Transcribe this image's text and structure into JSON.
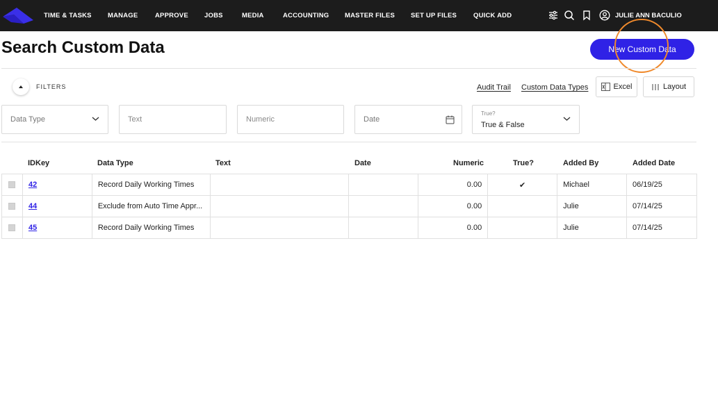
{
  "nav": {
    "items": [
      "TIME & TASKS",
      "MANAGE",
      "APPROVE",
      "JOBS",
      "MEDIA",
      "ACCOUNTING",
      "MASTER FILES",
      "SET UP FILES",
      "QUICK ADD"
    ],
    "user_name": "JULIE ANN BACULIO"
  },
  "header": {
    "title": "Search Custom Data",
    "new_button": "New Custom Data"
  },
  "filters": {
    "label": "FILTERS",
    "audit_trail": "Audit Trail",
    "custom_data_types": "Custom Data Types",
    "excel": "Excel",
    "layout": "Layout",
    "data_type_placeholder": "Data Type",
    "text_placeholder": "Text",
    "numeric_placeholder": "Numeric",
    "date_placeholder": "Date",
    "true_label": "True?",
    "true_value": "True & False"
  },
  "table": {
    "columns": [
      "IDKey",
      "Data Type",
      "Text",
      "Date",
      "Numeric",
      "True?",
      "Added By",
      "Added Date"
    ],
    "rows": [
      {
        "id": "42",
        "data_type": "Record Daily Working Times",
        "text": "",
        "date": "",
        "numeric": "0.00",
        "true": "✔",
        "added_by": "Michael",
        "added_date": "06/19/25"
      },
      {
        "id": "44",
        "data_type": "Exclude from Auto Time Appr...",
        "text": "",
        "date": "",
        "numeric": "0.00",
        "true": "",
        "added_by": "Julie",
        "added_date": "07/14/25"
      },
      {
        "id": "45",
        "data_type": "Record Daily Working Times",
        "text": "",
        "date": "",
        "numeric": "0.00",
        "true": "",
        "added_by": "Julie",
        "added_date": "07/14/25"
      }
    ]
  },
  "colors": {
    "nav_bg": "#1c1c1c",
    "accent": "#2f22e6",
    "highlight": "#f08a2c"
  }
}
